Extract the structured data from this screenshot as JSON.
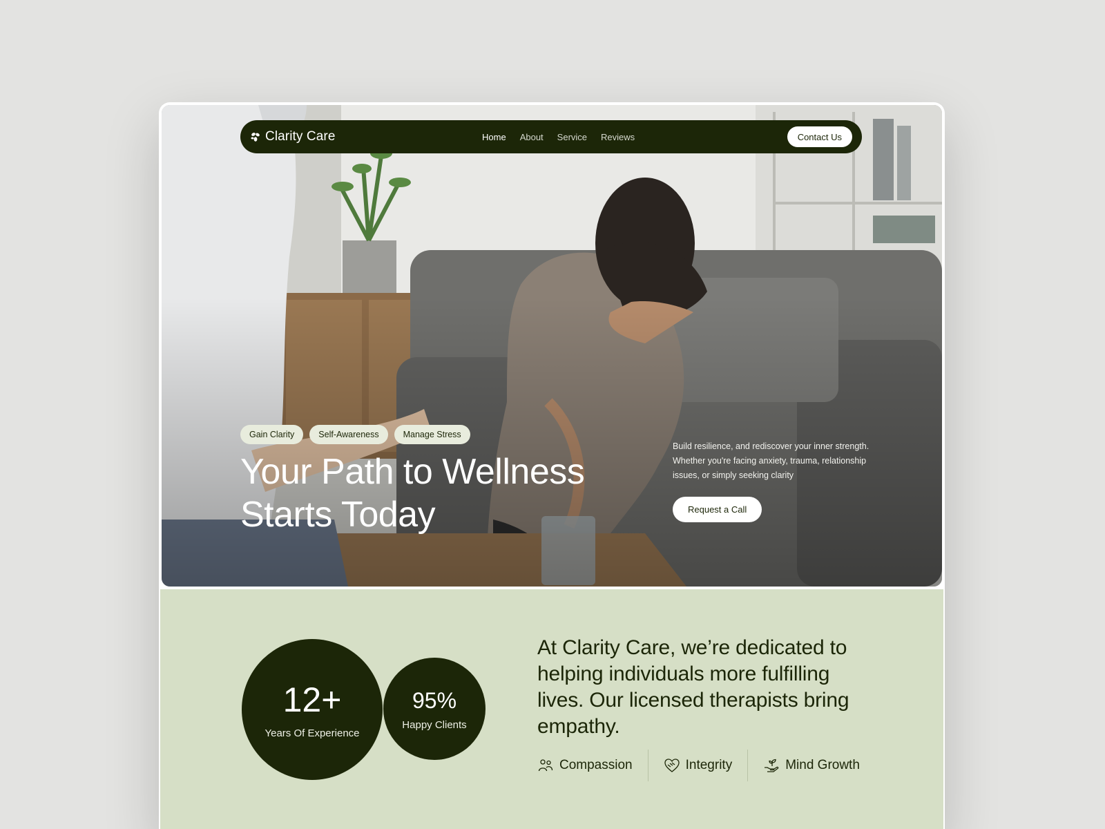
{
  "brand": {
    "name": "Clarity Care",
    "icon": "leaf-logo-icon"
  },
  "nav": {
    "items": [
      {
        "label": "Home",
        "active": true
      },
      {
        "label": "About",
        "active": false
      },
      {
        "label": "Service",
        "active": false
      },
      {
        "label": "Reviews",
        "active": false
      }
    ],
    "cta_label": "Contact Us"
  },
  "hero": {
    "tags": [
      "Gain Clarity",
      "Self-Awareness",
      "Manage Stress"
    ],
    "title_line1": "Your Path to Wellness",
    "title_line2": "Starts Today",
    "description": "Build resilience, and rediscover your inner strength. Whether you're facing anxiety, trauma, relationship issues, or simply seeking clarity",
    "cta_label": "Request a Call"
  },
  "stats": [
    {
      "value": "12+",
      "label": "Years Of Experience"
    },
    {
      "value": "95%",
      "label": "Happy Clients"
    }
  ],
  "mission": "At Clarity Care, we’re dedicated to helping individuals more fulfilling lives. Our licensed therapists bring empathy.",
  "values": [
    {
      "label": "Compassion",
      "icon": "people-icon"
    },
    {
      "label": "Integrity",
      "icon": "heart-handshake-icon"
    },
    {
      "label": "Mind Growth",
      "icon": "sprout-hand-icon"
    }
  ],
  "colors": {
    "primary": "#1c2608",
    "section_bg": "#d6dfc6",
    "page_bg": "#e3e3e1",
    "tag_bg": "#e8ecdd"
  }
}
